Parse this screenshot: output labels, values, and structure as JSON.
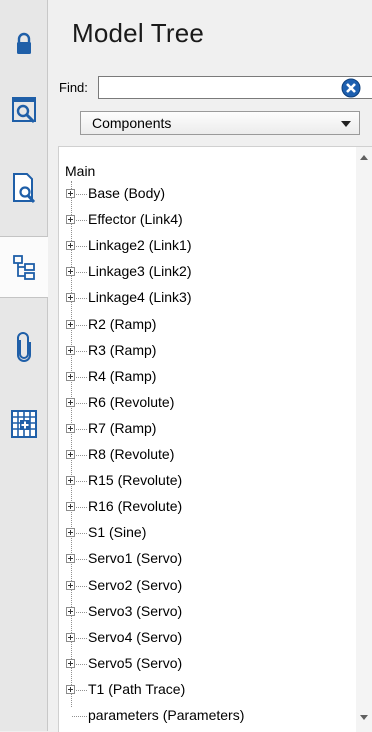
{
  "rail": {
    "buttons": [
      {
        "icon": "lock-icon"
      },
      {
        "icon": "screen-zoom-icon"
      },
      {
        "icon": "document-search-icon"
      },
      {
        "icon": "model-tree-icon",
        "active": true
      },
      {
        "icon": "paperclip-icon"
      },
      {
        "icon": "table-grid-icon"
      }
    ]
  },
  "panel": {
    "title": "Model Tree",
    "find_label": "Find:",
    "find_value": "",
    "filter_selected": "Components"
  },
  "tree": {
    "root": "Main",
    "nodes": [
      "Base (Body)",
      "Effector (Link4)",
      "Linkage2 (Link1)",
      "Linkage3 (Link2)",
      "Linkage4 (Link3)",
      "R2 (Ramp)",
      "R3 (Ramp)",
      "R4 (Ramp)",
      "R6 (Revolute)",
      "R7 (Ramp)",
      "R8 (Revolute)",
      "R15 (Revolute)",
      "R16 (Revolute)",
      "S1 (Sine)",
      "Servo1 (Servo)",
      "Servo2 (Servo)",
      "Servo3 (Servo)",
      "Servo4 (Servo)",
      "Servo5 (Servo)",
      "T1 (Path Trace)"
    ],
    "leaf": "parameters (Parameters)"
  },
  "colors": {
    "accent": "#1f5fa8",
    "clear_button": "#1e60b0"
  }
}
